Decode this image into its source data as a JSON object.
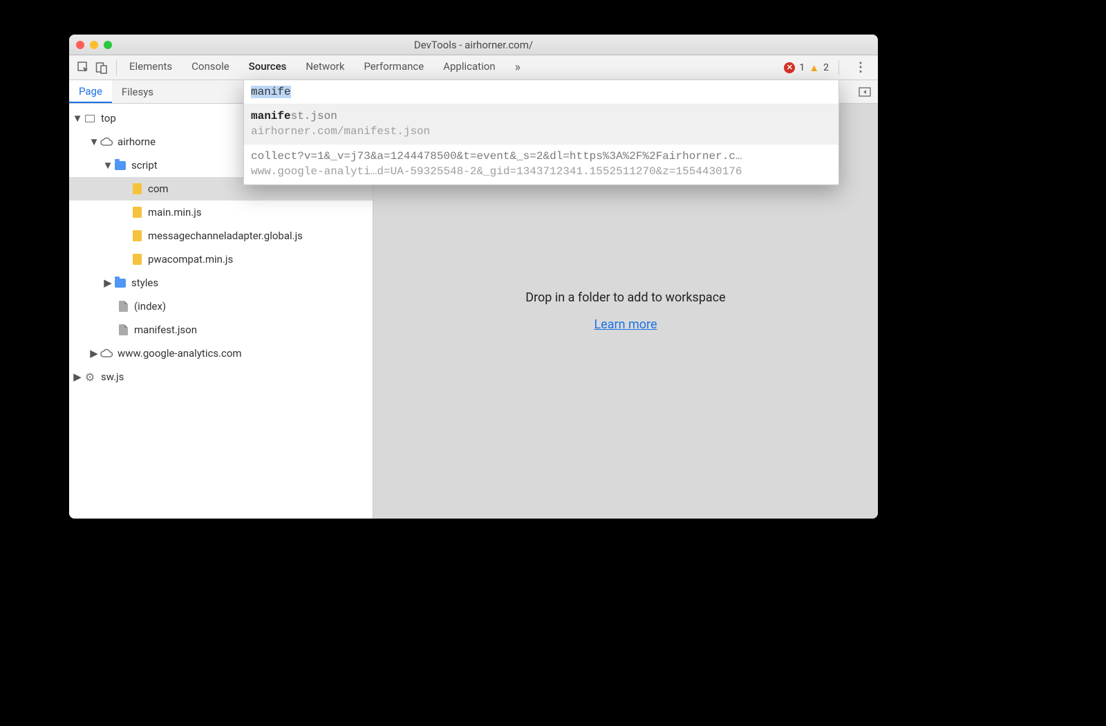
{
  "window": {
    "title": "DevTools - airhorner.com/"
  },
  "toolbar": {
    "tabs": [
      "Elements",
      "Console",
      "Sources",
      "Network",
      "Performance",
      "Application"
    ],
    "active_tab": "Sources",
    "overflow": "»",
    "errors_count": "1",
    "warnings_count": "2"
  },
  "subtabs": {
    "items": [
      "Page",
      "Filesys"
    ],
    "active": "Page"
  },
  "autocomplete": {
    "query": "manife",
    "suggestions": [
      {
        "title_bold": "manife",
        "title_rest": "st.json",
        "subtitle": "airhorner.com/manifest.json",
        "selected": true
      },
      {
        "title_bold": "",
        "title_rest": "collect?v=1&_v=j73&a=1244478500&t=event&_s=2&dl=https%3A%2F%2Fairhorner.c…",
        "subtitle": "www.google-analyti…d=UA-59325548-2&_gid=1343712341.1552511270&z=1554430176",
        "selected": false
      }
    ]
  },
  "tree": {
    "top": "top",
    "domain1": "airhorne",
    "folder_scripts": "script",
    "file_truncated": "com",
    "file_main": "main.min.js",
    "file_msgchannel": "messagechanneladapter.global.js",
    "file_pwacompat": "pwacompat.min.js",
    "folder_styles": "styles",
    "file_index": "(index)",
    "file_manifest": "manifest.json",
    "domain2": "www.google-analytics.com",
    "sw": "sw.js"
  },
  "content": {
    "drop_msg": "Drop in a folder to add to workspace",
    "learn_more": "Learn more"
  }
}
